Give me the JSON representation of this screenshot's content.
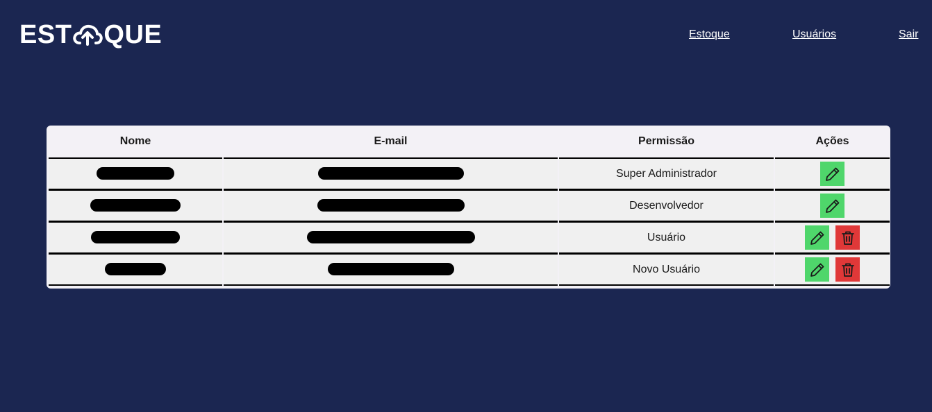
{
  "header": {
    "logo_left": "EST",
    "logo_right": "QUE",
    "logo_icon": "cloud-upload-icon",
    "nav": [
      "Estoque",
      "Usuários",
      "Sair"
    ]
  },
  "table": {
    "columns": [
      "Nome",
      "E-mail",
      "Permissão",
      "Ações"
    ],
    "rows": [
      {
        "permission": "Super Administrador",
        "can_delete": false
      },
      {
        "permission": "Desenvolvedor",
        "can_delete": false
      },
      {
        "permission": "Usuário",
        "can_delete": true
      },
      {
        "permission": "Novo Usuário",
        "can_delete": true
      }
    ]
  },
  "icons": {
    "edit": "pencil-icon",
    "delete": "trash-icon"
  },
  "colors": {
    "background": "#1b2651",
    "table_bg": "#f3f1f6",
    "edit_button": "#4fd66b",
    "delete_button": "#e03838"
  }
}
